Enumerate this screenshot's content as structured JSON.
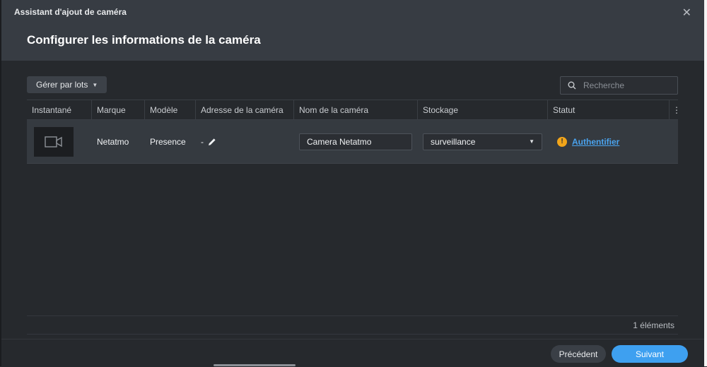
{
  "window": {
    "title": "Assistant d'ajout de caméra",
    "close_icon": "close-icon"
  },
  "header": {
    "heading": "Configurer les informations de la caméra"
  },
  "toolbar": {
    "batch_label": "Gérer par lots",
    "search_placeholder": "Recherche"
  },
  "table": {
    "columns": [
      "Instantané",
      "Marque",
      "Modèle",
      "Adresse de la caméra",
      "Nom de la caméra",
      "Stockage",
      "Statut"
    ],
    "rows": [
      {
        "snapshot_icon": "camera-icon",
        "brand": "Netatmo",
        "model": "Presence",
        "address": "-",
        "name": "Camera Netatmo",
        "storage": "surveillance",
        "status_link": "Authentifier",
        "status_icon": "warning-icon"
      }
    ],
    "count_label": "1 éléments"
  },
  "footer": {
    "prev_label": "Précédent",
    "next_label": "Suivant"
  },
  "colors": {
    "accent": "#3ea0f0",
    "warning": "#f2a51a",
    "link": "#4aa3ee"
  }
}
